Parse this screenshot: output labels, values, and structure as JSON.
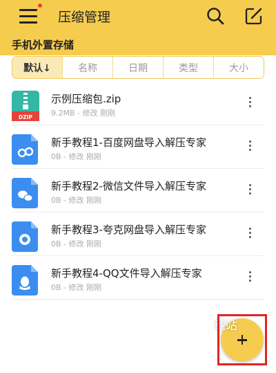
{
  "header": {
    "title": "压缩管理",
    "menu_icon": "hamburger-menu-icon",
    "notification_color": "#e8453c",
    "search_icon": "search-icon",
    "edit_icon": "edit-icon"
  },
  "storage": {
    "title": "手机外置存储"
  },
  "sort_tabs": [
    {
      "label": "默认↓",
      "active": true
    },
    {
      "label": "名称"
    },
    {
      "label": "日期"
    },
    {
      "label": "类型"
    },
    {
      "label": "大小"
    }
  ],
  "files": [
    {
      "name": "示例压缩包.zip",
      "size": "9.2MB",
      "separator": "-",
      "action": "修改",
      "time": "刚刚",
      "icon": "zip-archive-icon",
      "icon_label": "DZIP"
    },
    {
      "name": "新手教程1-百度网盘导入解压专家",
      "size": "0B",
      "separator": "-",
      "action": "修改",
      "time": "刚刚",
      "icon": "baidu-netdisk-file-icon"
    },
    {
      "name": "新手教程2-微信文件导入解压专家",
      "size": "0B",
      "separator": "-",
      "action": "修改",
      "time": "刚刚",
      "icon": "wechat-file-icon"
    },
    {
      "name": "新手教程3-夸克网盘导入解压专家",
      "size": "0B",
      "separator": "-",
      "action": "修改",
      "time": "刚刚",
      "icon": "quark-file-icon"
    },
    {
      "name": "新手教程4-QQ文件导入解压专家",
      "size": "0B",
      "separator": "-",
      "action": "修改",
      "time": "刚刚",
      "icon": "qq-file-icon"
    }
  ],
  "fab": {
    "icon": "plus-icon",
    "color": "#f6cc4f"
  },
  "watermark": "载站",
  "colors": {
    "accent": "#f6cc4f",
    "highlight": "#e02323",
    "file_blue": "#3b8ef0"
  }
}
